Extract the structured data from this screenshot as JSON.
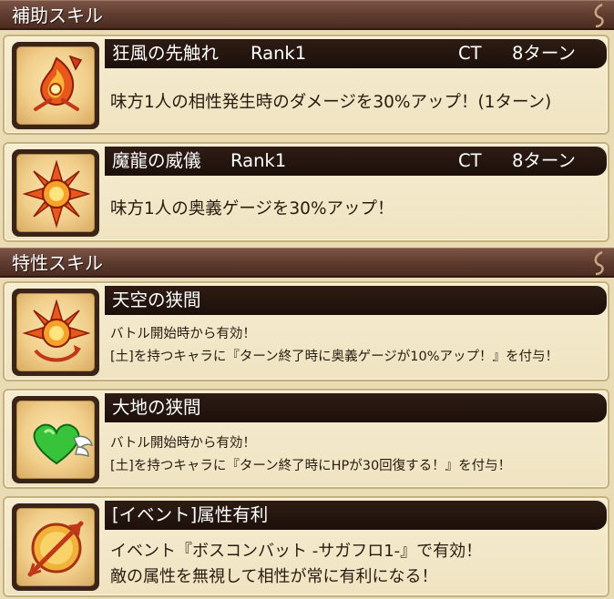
{
  "sections": {
    "support": {
      "label": "補助スキル"
    },
    "trait": {
      "label": "特性スキル"
    }
  },
  "support_skills": [
    {
      "name": "狂風の先触れ",
      "rank": "Rank1",
      "ct_label": "CT",
      "turns": "8ターン",
      "description": "味方1人の相性発生時のダメージを30%アップ！(1ターン)",
      "icon": "wind-flame-icon"
    },
    {
      "name": "魔龍の威儀",
      "rank": "Rank1",
      "ct_label": "CT",
      "turns": "8ターン",
      "description": "味方1人の奥義ゲージを30%アップ！",
      "icon": "sun-burst-icon"
    }
  ],
  "trait_skills": [
    {
      "name": "天空の狭間",
      "lines": [
        "バトル開始時から有効！",
        "[土]を持つキャラに『ターン終了時に奥義ゲージが10%アップ！』を付与！"
      ],
      "icon": "sun-burst-arrows-icon"
    },
    {
      "name": "大地の狭間",
      "lines": [
        "バトル開始時から有効！",
        "[土]を持つキャラに『ターン終了時にHPが30回復する！』を付与！"
      ],
      "icon": "winged-heart-icon"
    },
    {
      "name": "[イベント]属性有利",
      "lines": [
        "イベント『ボスコンバット -サガフロ1-』で有効！",
        "敵の属性を無視して相性が常に有利になる！"
      ],
      "icon": "crossed-arrow-icon"
    }
  ],
  "colors": {
    "header": "#5d3a2e",
    "title_bar": "#1c100a",
    "card_bg": "#f3e8c9",
    "page_bg": "#e9dcb4"
  }
}
